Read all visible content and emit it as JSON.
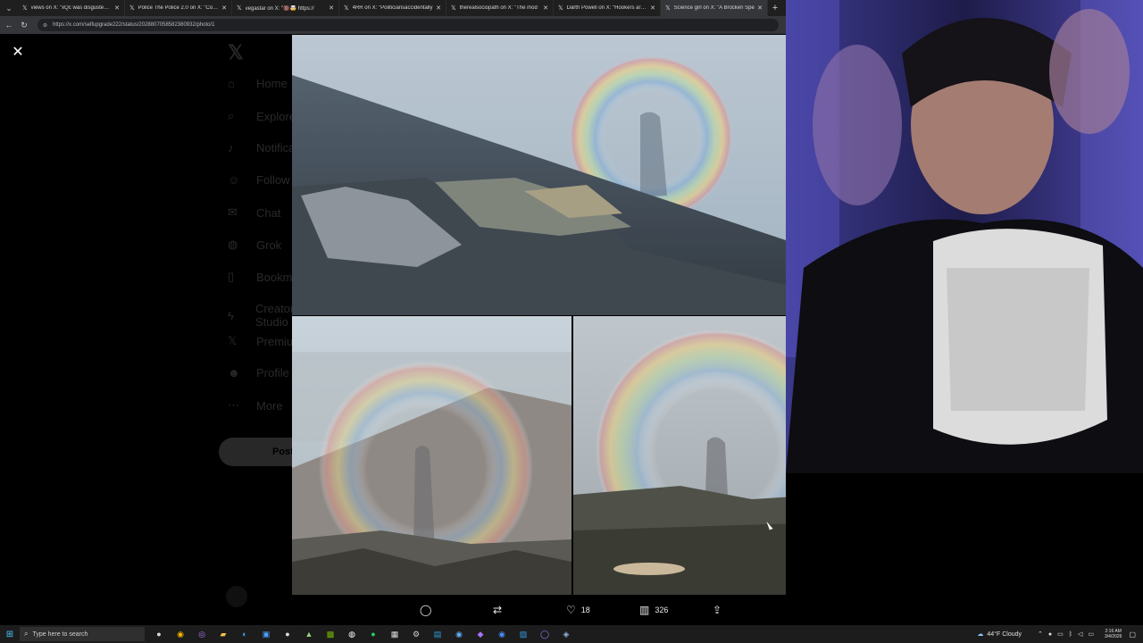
{
  "browser": {
    "tabs": [
      {
        "icon": "x-logo-icon",
        "title": "views on X: \"xQc was disgusted at",
        "active": false
      },
      {
        "icon": "x-logo-icon",
        "title": "Police The Police 2.0 on X: \"Cop lit",
        "active": false
      },
      {
        "icon": "x-logo-icon",
        "title": "vegastar on X: \"🔞🤯 https://",
        "active": false
      },
      {
        "icon": "x-logo-icon",
        "title": "4RR on X: \"Politiciansaccidentally",
        "active": false
      },
      {
        "icon": "x-logo-icon",
        "title": "therealsociopath on X: \"The mod",
        "active": false
      },
      {
        "icon": "x-logo-icon",
        "title": "Darth Powell on X: \"Hookers are m",
        "active": false
      },
      {
        "icon": "x-logo-icon",
        "title": "Science girl on X: \"A Brocken Spe",
        "active": true
      }
    ],
    "url": "https://x.com/selfupgrade222/status/2028807058582380932/photo/1"
  },
  "sidebar": {
    "items": [
      {
        "icon": "home-icon",
        "label": "Home"
      },
      {
        "icon": "search-icon",
        "label": "Explore"
      },
      {
        "icon": "bell-icon",
        "label": "Notifications"
      },
      {
        "icon": "people-icon",
        "label": "Follow"
      },
      {
        "icon": "mail-icon",
        "label": "Chat"
      },
      {
        "icon": "grok-icon",
        "label": "Grok"
      },
      {
        "icon": "bookmark-icon",
        "label": "Bookmarks"
      },
      {
        "icon": "lightning-icon",
        "label": "Creator Studio"
      },
      {
        "icon": "x-logo-icon",
        "label": "Premium"
      },
      {
        "icon": "person-icon",
        "label": "Profile"
      },
      {
        "icon": "more-icon",
        "label": "More"
      }
    ],
    "post_label": "Post"
  },
  "actions": {
    "reply_icon": "reply-icon",
    "repost_icon": "repost-icon",
    "like_count": "18",
    "views_count": "326",
    "share_icon": "share-icon"
  },
  "taskbar": {
    "search_placeholder": "Type here to search",
    "weather": "44°F  Cloudy",
    "time": "2:16 AM",
    "date": "3/4/2026"
  },
  "colors": {
    "tab_bg": "#1f1f1f",
    "active_tab_bg": "#35363a",
    "page_bg": "#000000",
    "taskbar_bg": "#1c1c1c"
  }
}
